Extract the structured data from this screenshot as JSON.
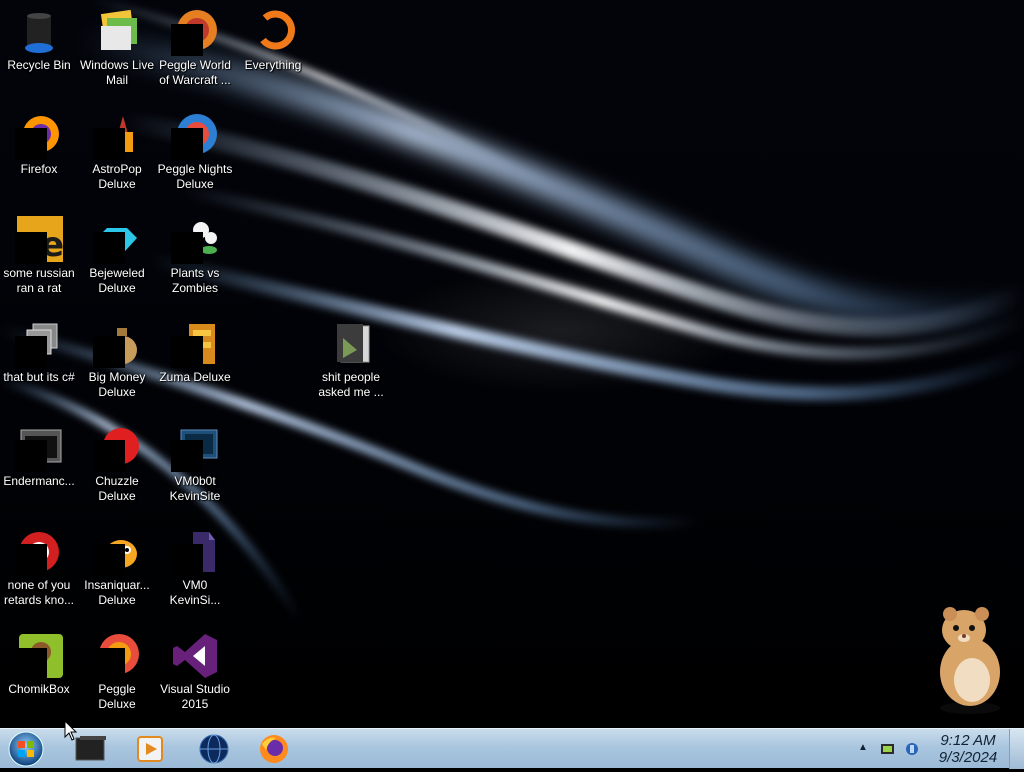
{
  "desktop": {
    "icons": [
      {
        "label": "Recycle Bin",
        "icon": "recycle-bin-icon"
      },
      {
        "label": "Windows Live Mail",
        "icon": "windows-live-mail-icon"
      },
      {
        "label": "Peggle World of Warcraft ...",
        "icon": "peggle-wow-icon"
      },
      {
        "label": "Everything",
        "icon": "everything-search-icon"
      },
      {
        "label": "Firefox",
        "icon": "firefox-icon"
      },
      {
        "label": "AstroPop Deluxe",
        "icon": "astropop-icon"
      },
      {
        "label": "Peggle Nights Deluxe",
        "icon": "peggle-nights-icon"
      },
      {
        "label": "some russian ran a rat",
        "icon": "archive-e-icon"
      },
      {
        "label": "Bejeweled Deluxe",
        "icon": "bejeweled-icon"
      },
      {
        "label": "Plants vs Zombies",
        "icon": "plants-vs-zombies-icon"
      },
      {
        "label": "that but its c#",
        "icon": "stacked-windows-icon"
      },
      {
        "label": "Big Money Deluxe",
        "icon": "big-money-icon"
      },
      {
        "label": "Zuma Deluxe",
        "icon": "zuma-icon"
      },
      {
        "label": "shit people asked me ...",
        "icon": "folder-icon"
      },
      {
        "label": "Endermanc...",
        "icon": "terminal-window-icon"
      },
      {
        "label": "Chuzzle Deluxe",
        "icon": "chuzzle-icon"
      },
      {
        "label": "VM0b0t KevinSite",
        "icon": "vm-display-icon"
      },
      {
        "label": "none of you retards kno...",
        "icon": "red-app-icon"
      },
      {
        "label": "Insaniquar... Deluxe",
        "icon": "insaniquarium-icon"
      },
      {
        "label": "VM0 KevinSi...",
        "icon": "purple-file-icon"
      },
      {
        "label": "ChomikBox",
        "icon": "chomikbox-icon"
      },
      {
        "label": "Peggle Deluxe",
        "icon": "peggle-icon"
      },
      {
        "label": "Visual Studio 2015",
        "icon": "visual-studio-icon"
      }
    ]
  },
  "taskbar": {
    "items": [
      {
        "name": "start-orb-icon"
      },
      {
        "name": "window-switcher-icon"
      },
      {
        "name": "media-player-icon"
      },
      {
        "name": "globe-icon"
      },
      {
        "name": "firefox-icon"
      }
    ],
    "tray": {
      "icons": [
        "show-hidden-icons-arrow-icon",
        "battery-icon",
        "network-icon"
      ]
    },
    "clock": {
      "time": "9:12 AM",
      "date": "9/3/2024"
    }
  },
  "colors": {
    "taskbar_top": "#c9dcec",
    "taskbar_bottom": "#9bbad7",
    "desktop_bg": "#02040a"
  }
}
